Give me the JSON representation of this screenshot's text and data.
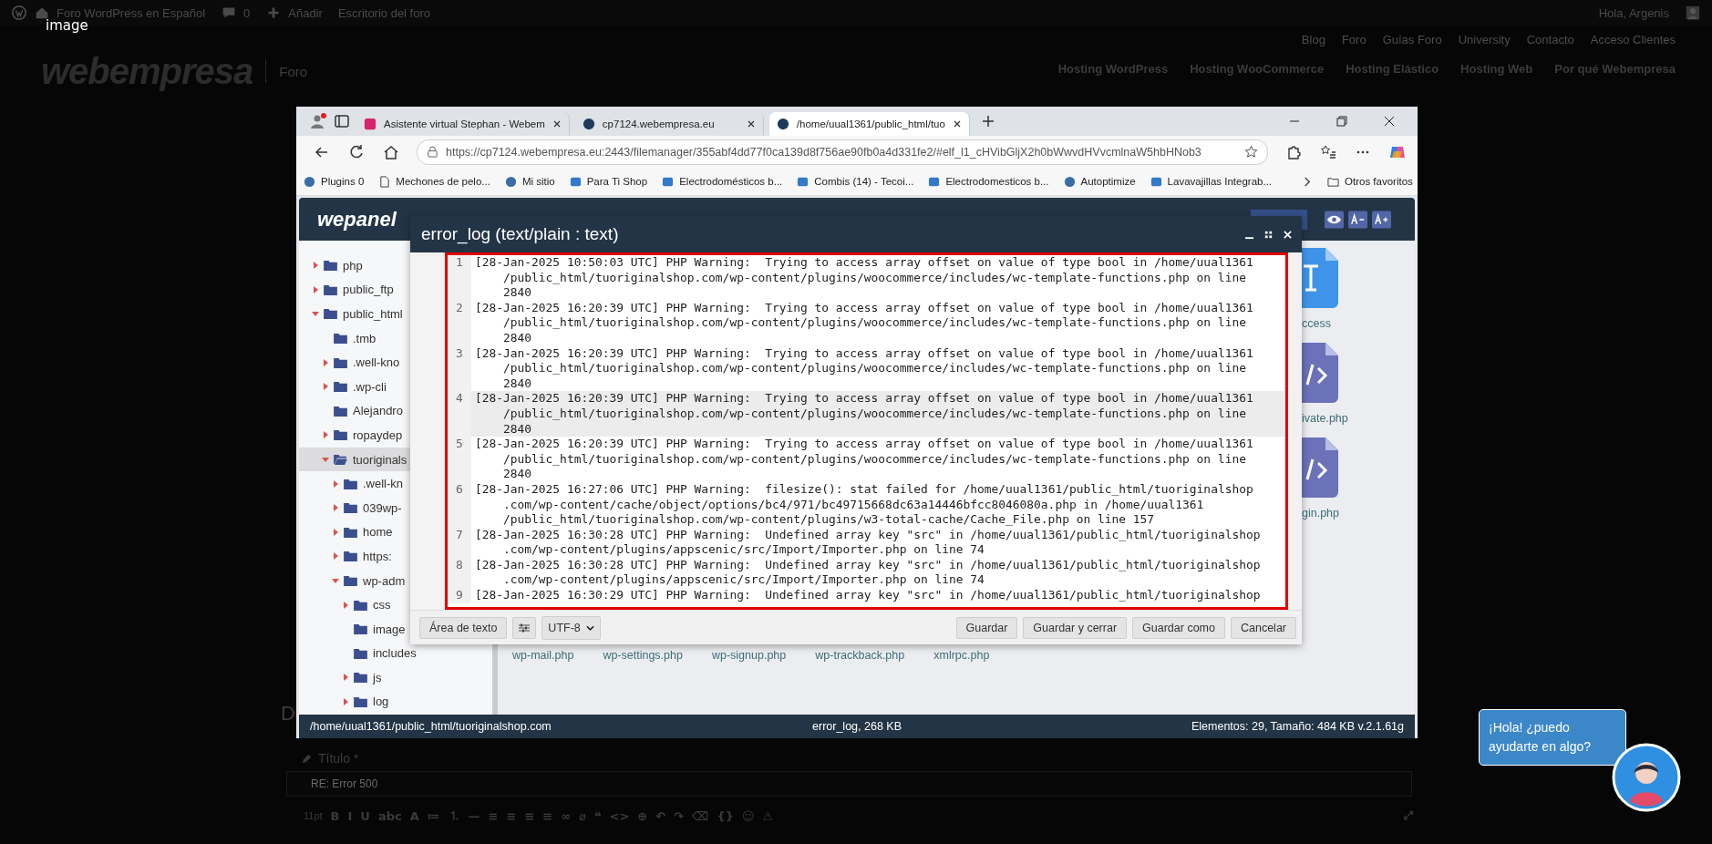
{
  "lightbox_caption": "image",
  "admin_bar": {
    "site": "Foro WordPress en Español",
    "comments": "0",
    "new": "Añadir",
    "dashboard": "Escritorio del foro",
    "greeting": "Hola, Argenis"
  },
  "header": {
    "logo": "webempresa",
    "section": "Foro",
    "top_links": [
      "Blog",
      "Foro",
      "Guías Foro",
      "University",
      "Contacto",
      "Acceso Clientes"
    ],
    "main_links": [
      "Hosting WordPress",
      "Hosting WooCommerce",
      "Hosting Elástico",
      "Hosting Web",
      "Por qué Webempresa"
    ]
  },
  "screenshot": {
    "browser": {
      "tabs": [
        {
          "title": "Asistente virtual Stephan - Webem",
          "selected": false
        },
        {
          "title": "cp7124.webempresa.eu",
          "selected": false
        },
        {
          "title": "/home/uual1361/public_html/tuo",
          "selected": true
        }
      ],
      "url": "https://cp7124.webempresa.eu:2443/filemanager/355abf4dd77f0ca139d8f756ae90fb0a4d331fe2/#elf_l1_cHVibGljX2h0bWwvdHVvcmlnaW5hbHNob3",
      "bookmarks": [
        {
          "label": "Plugins 0",
          "kind": "circle"
        },
        {
          "label": "Mechones de pelo...",
          "kind": "page"
        },
        {
          "label": "Mi sitio",
          "kind": "circle"
        },
        {
          "label": "Para Ti Shop",
          "kind": "square"
        },
        {
          "label": "Electrodomésticos b...",
          "kind": "square"
        },
        {
          "label": "Combis (14) - Tecoi...",
          "kind": "square"
        },
        {
          "label": "Electrodomesticos b...",
          "kind": "square"
        },
        {
          "label": "Autoptimize",
          "kind": "circle"
        },
        {
          "label": "Lavavajillas Integrab...",
          "kind": "square"
        }
      ],
      "other_bookmarks": "Otros favoritos"
    },
    "wepanel": {
      "logo": "wepanel",
      "tree": [
        {
          "name": "php",
          "expanded": false,
          "selected": false
        },
        {
          "name": "public_ftp",
          "expanded": false,
          "selected": false
        },
        {
          "name": "public_html",
          "expanded": true,
          "selected": false,
          "children": [
            {
              "name": ".tmb",
              "selected": false
            },
            {
              "name": ".well-kno",
              "expanded": false,
              "selected": false
            },
            {
              "name": ".wp-cli",
              "expanded": false,
              "selected": false
            },
            {
              "name": "Alejandro",
              "selected": false
            },
            {
              "name": "ropaydep",
              "expanded": false,
              "selected": false
            },
            {
              "name": "tuoriginals",
              "expanded": true,
              "selected": true,
              "children": [
                {
                  "name": ".well-kn",
                  "expanded": false,
                  "selected": false
                },
                {
                  "name": "039wp-",
                  "expanded": false,
                  "selected": false
                },
                {
                  "name": "home",
                  "expanded": false,
                  "selected": false
                },
                {
                  "name": "https:",
                  "expanded": false,
                  "selected": false
                },
                {
                  "name": "wp-adm",
                  "expanded": true,
                  "selected": false,
                  "children": [
                    {
                      "name": "css",
                      "expanded": false,
                      "selected": false
                    },
                    {
                      "name": "image",
                      "selected": false
                    },
                    {
                      "name": "includes",
                      "selected": false
                    },
                    {
                      "name": "js",
                      "expanded": false,
                      "selected": false
                    },
                    {
                      "name": "log",
                      "expanded": false,
                      "selected": false
                    }
                  ]
                }
              ]
            }
          ]
        }
      ],
      "files_right": [
        {
          "label": "ccess",
          "kind": "text"
        },
        {
          "label": "ivate.php",
          "kind": "code"
        },
        {
          "label": "gin.php",
          "kind": "code"
        }
      ],
      "files_bottom": [
        "wp-mail.php",
        "wp-settings.php",
        "wp-signup.php",
        "wp-trackback.php",
        "xmlrpc.php"
      ],
      "status": {
        "path": "/home/uual1361/public_html/tuoriginalshop.com",
        "file": "error_log, 268 KB",
        "summary": "Elementos: 29, Tamaño: 484 KB v.2.1.61g"
      },
      "dialog": {
        "title": "error_log (text/plain : text)",
        "log": [
          {
            "number": "1",
            "selected": false,
            "lines": [
              "[28-Jan-2025 10:50:03 UTC] PHP Warning:  Trying to access array offset on value of type bool in /home/uual1361",
              "/public_html/tuoriginalshop.com/wp-content/plugins/woocommerce/includes/wc-template-functions.php on line",
              "2840"
            ]
          },
          {
            "number": "2",
            "selected": false,
            "lines": [
              "[28-Jan-2025 16:20:39 UTC] PHP Warning:  Trying to access array offset on value of type bool in /home/uual1361",
              "/public_html/tuoriginalshop.com/wp-content/plugins/woocommerce/includes/wc-template-functions.php on line",
              "2840"
            ]
          },
          {
            "number": "3",
            "selected": false,
            "lines": [
              "[28-Jan-2025 16:20:39 UTC] PHP Warning:  Trying to access array offset on value of type bool in /home/uual1361",
              "/public_html/tuoriginalshop.com/wp-content/plugins/woocommerce/includes/wc-template-functions.php on line",
              "2840"
            ]
          },
          {
            "number": "4",
            "selected": true,
            "lines": [
              "[28-Jan-2025 16:20:39 UTC] PHP Warning:  Trying to access array offset on value of type bool in /home/uual1361",
              "/public_html/tuoriginalshop.com/wp-content/plugins/woocommerce/includes/wc-template-functions.php on line",
              "2840"
            ]
          },
          {
            "number": "5",
            "selected": false,
            "lines": [
              "[28-Jan-2025 16:20:39 UTC] PHP Warning:  Trying to access array offset on value of type bool in /home/uual1361",
              "/public_html/tuoriginalshop.com/wp-content/plugins/woocommerce/includes/wc-template-functions.php on line",
              "2840"
            ]
          },
          {
            "number": "6",
            "selected": false,
            "lines": [
              "[28-Jan-2025 16:27:06 UTC] PHP Warning:  filesize(): stat failed for /home/uual1361/public_html/tuoriginalshop",
              ".com/wp-content/cache/object/options/bc4/971/bc49715668dc63a14446bfcc8046080a.php in /home/uual1361",
              "/public_html/tuoriginalshop.com/wp-content/plugins/w3-total-cache/Cache_File.php on line 157"
            ]
          },
          {
            "number": "7",
            "selected": false,
            "lines": [
              "[28-Jan-2025 16:30:28 UTC] PHP Warning:  Undefined array key \"src\" in /home/uual1361/public_html/tuoriginalshop",
              ".com/wp-content/plugins/appscenic/src/Import/Importer.php on line 74"
            ]
          },
          {
            "number": "8",
            "selected": false,
            "lines": [
              "[28-Jan-2025 16:30:28 UTC] PHP Warning:  Undefined array key \"src\" in /home/uual1361/public_html/tuoriginalshop",
              ".com/wp-content/plugins/appscenic/src/Import/Importer.php on line 74"
            ]
          },
          {
            "number": "9",
            "selected": false,
            "lines": [
              "[28-Jan-2025 16:30:29 UTC] PHP Warning:  Undefined array key \"src\" in /home/uual1361/public_html/tuoriginalshop"
            ]
          }
        ],
        "mode_button": "Área de texto",
        "encoding": "UTF-8",
        "buttons": [
          "Guardar",
          "Guardar y cerrar",
          "Guardar como",
          "Cancelar"
        ]
      }
    }
  },
  "form": {
    "cut_heading": "D",
    "title_label": "Título *",
    "title_value": "RE: Error 500",
    "font_size": "11pt",
    "toolbar": [
      "B",
      "I",
      "U",
      "abc",
      "A",
      "≔",
      "⒈",
      "—",
      "≡",
      "≡",
      "≡",
      "≡",
      "∞",
      "⌀",
      "❝",
      "<>",
      "⊕",
      "↶",
      "↷",
      "⌫",
      "{}",
      "☺",
      "⚠"
    ],
    "expand": "⤢"
  },
  "chat": {
    "message": "¡Hola! ¿puedo ayudarte en algo?"
  }
}
